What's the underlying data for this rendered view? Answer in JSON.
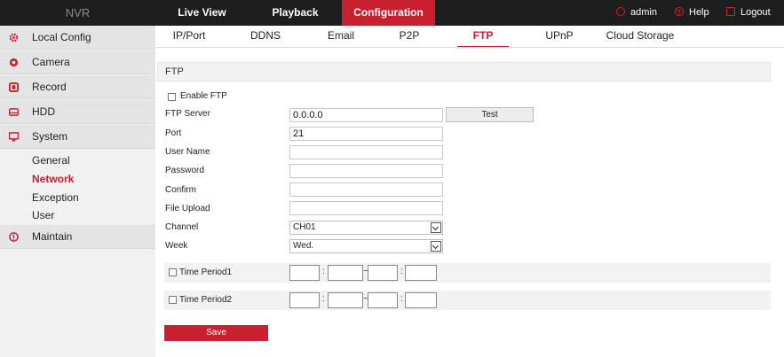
{
  "app": {
    "brand": "NVR"
  },
  "topnav": [
    {
      "label": "Live View",
      "active": false
    },
    {
      "label": "Playback",
      "active": false
    },
    {
      "label": "Configuration",
      "active": true
    }
  ],
  "topright": {
    "user": "admin",
    "help": "Help",
    "logout": "Logout"
  },
  "sidebar": {
    "items": [
      {
        "label": "Local Config",
        "icon": "gear-icon"
      },
      {
        "label": "Camera",
        "icon": "camera-icon"
      },
      {
        "label": "Record",
        "icon": "record-icon"
      },
      {
        "label": "HDD",
        "icon": "hdd-icon"
      },
      {
        "label": "System",
        "icon": "monitor-icon"
      },
      {
        "label": "Maintain",
        "icon": "info-icon"
      }
    ],
    "subitems": [
      {
        "label": "General",
        "active": false
      },
      {
        "label": "Network",
        "active": true
      },
      {
        "label": "Exception",
        "active": false
      },
      {
        "label": "User",
        "active": false
      }
    ]
  },
  "subtabs": [
    {
      "label": "IP/Port",
      "active": false
    },
    {
      "label": "DDNS",
      "active": false
    },
    {
      "label": "Email",
      "active": false
    },
    {
      "label": "P2P",
      "active": false
    },
    {
      "label": "FTP",
      "active": true
    },
    {
      "label": "UPnP",
      "active": false
    },
    {
      "label": "Cloud Storage",
      "active": false
    }
  ],
  "form": {
    "section_title": "FTP",
    "enable_label": "Enable FTP",
    "enable_checked": false,
    "ftp_server_label": "FTP Server",
    "ftp_server_value": "0.0.0.0",
    "test_label": "Test",
    "port_label": "Port",
    "port_value": "21",
    "username_label": "User Name",
    "username_value": "",
    "password_label": "Password",
    "password_value": "",
    "confirm_label": "Confirm",
    "confirm_value": "",
    "file_upload_label": "File Upload",
    "file_upload_value": "",
    "channel_label": "Channel",
    "channel_value": "CH01",
    "week_label": "Week",
    "week_value": "Wed.",
    "period1_label": "Time Period1",
    "period2_label": "Time Period2",
    "time_colon": ":",
    "time_tilde": "~",
    "save_label": "Save"
  },
  "colors": {
    "accent": "#c8202f",
    "topbar": "#1e1e1e",
    "sidebar": "#f1f1f1"
  }
}
